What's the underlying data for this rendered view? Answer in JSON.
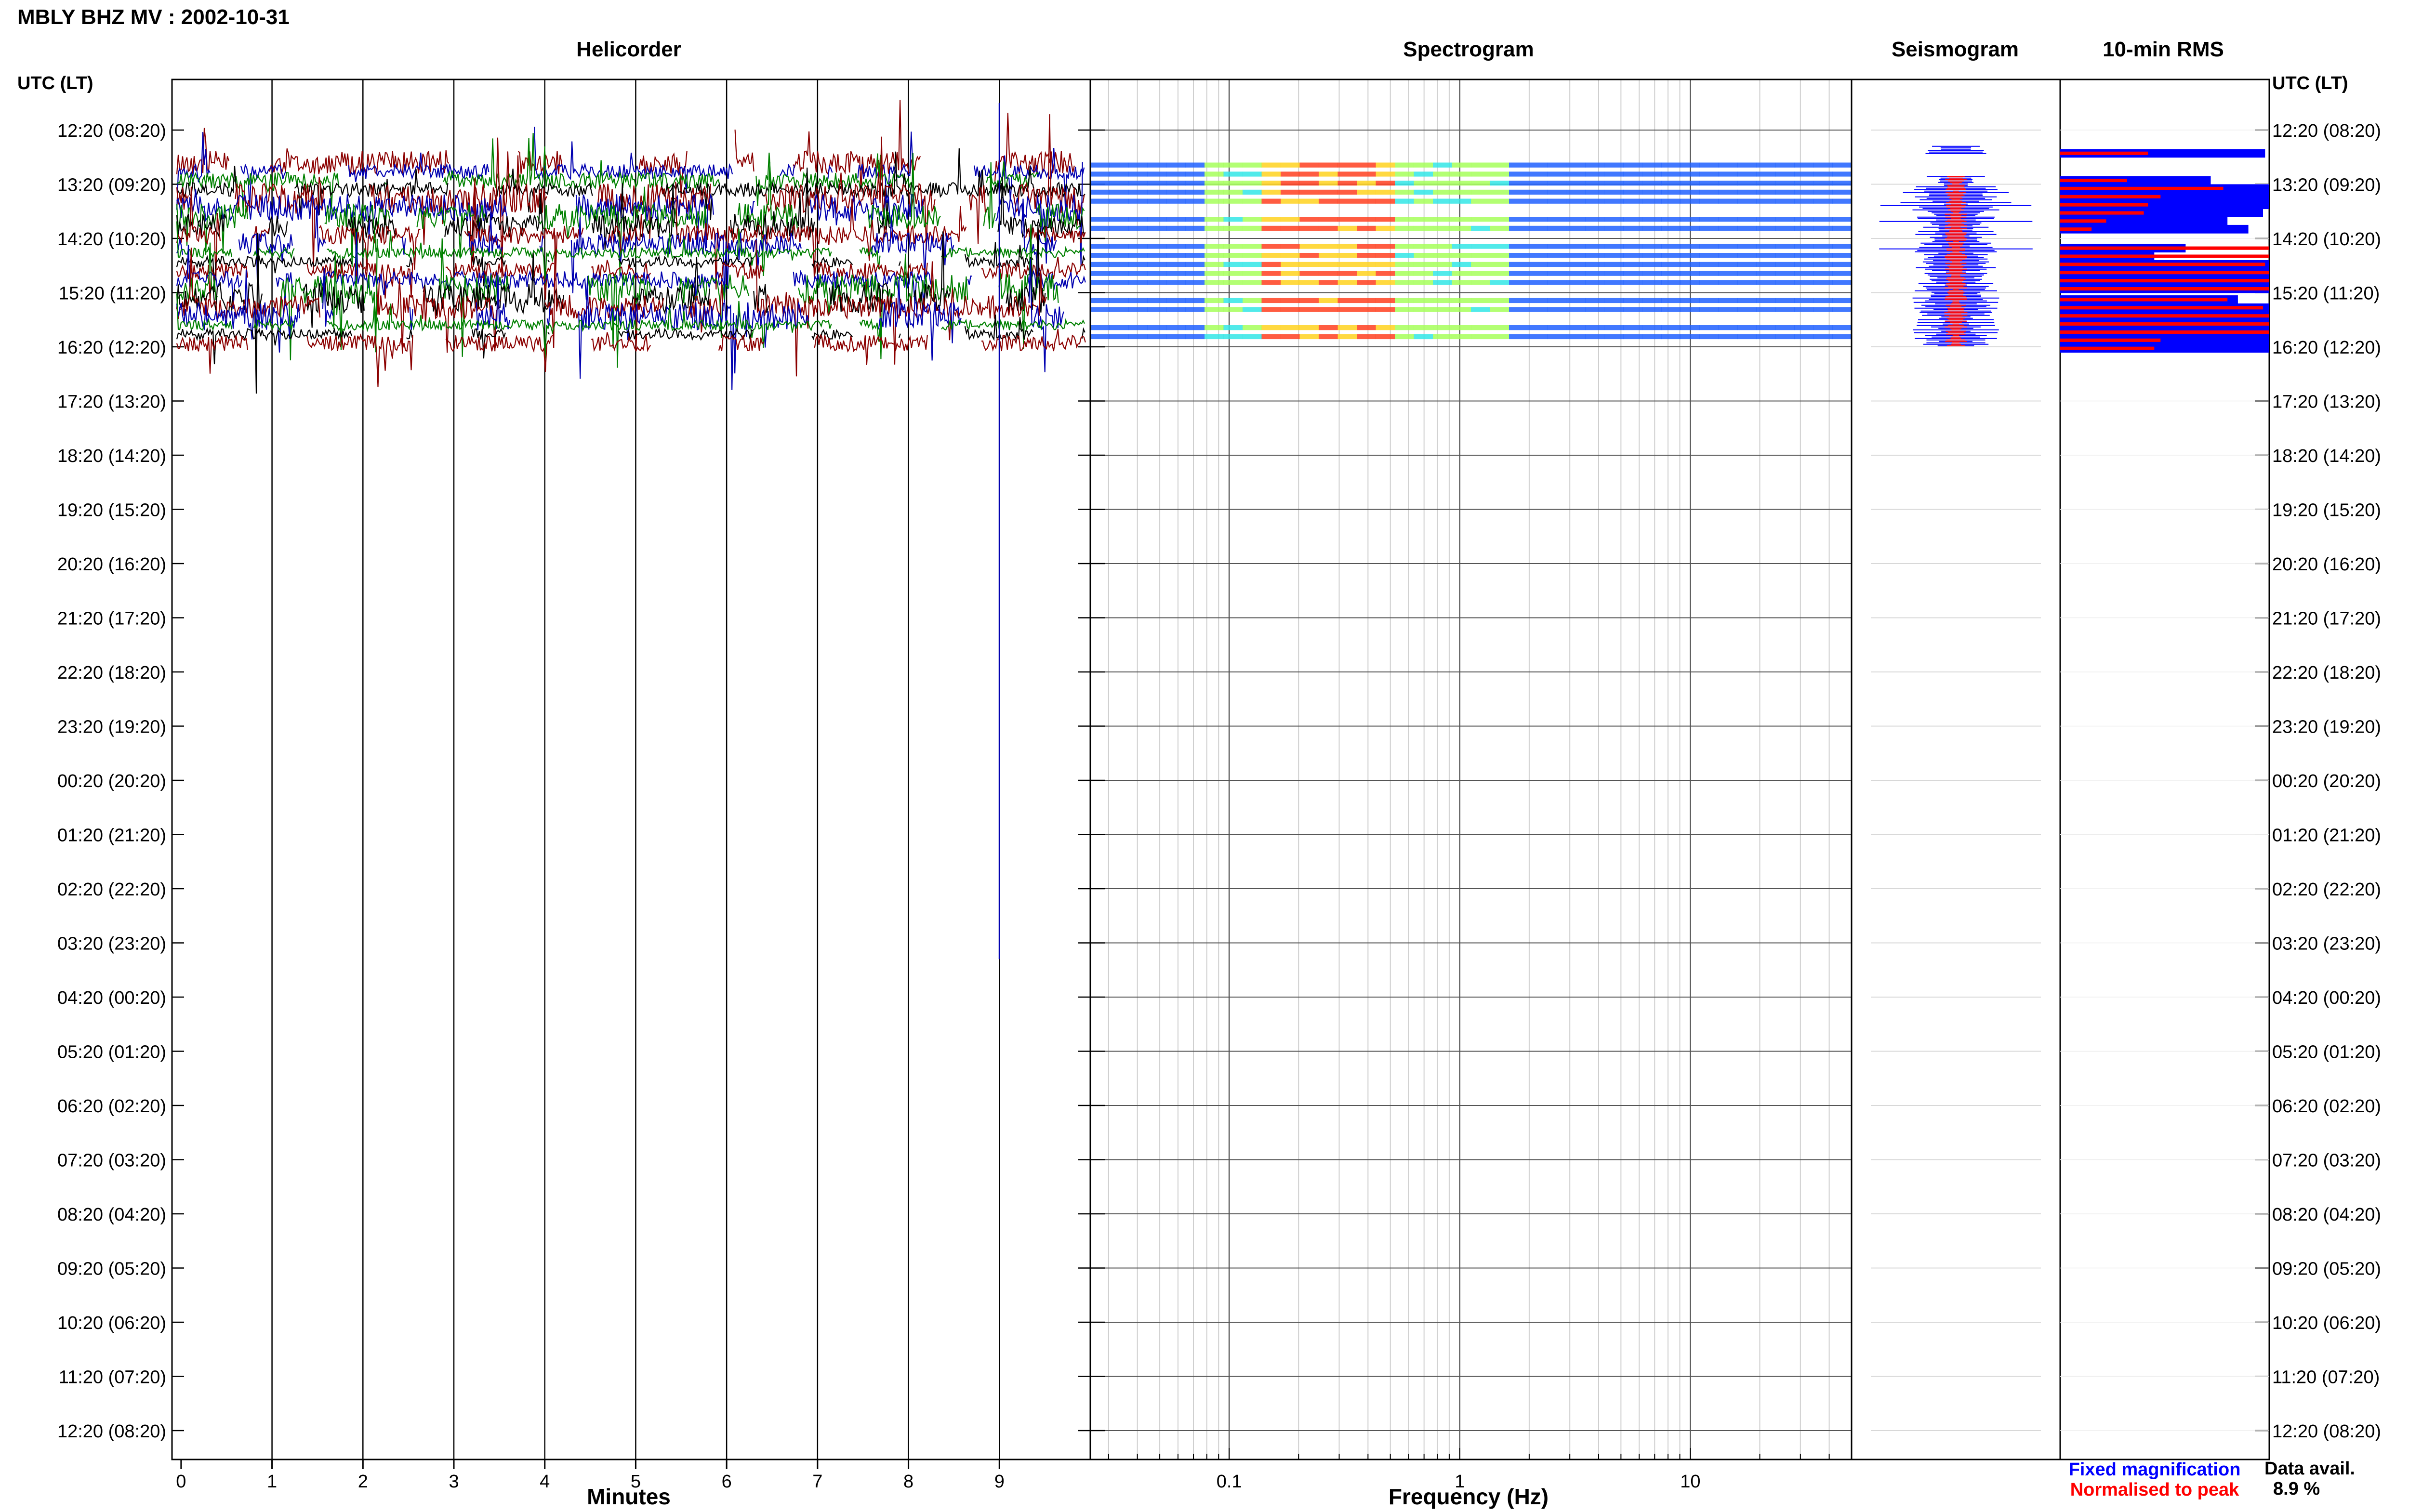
{
  "figure": {
    "header": "MBLY BHZ MV : 2002-10-31",
    "axis_heading": "UTC (LT)",
    "panel_titles": {
      "helicorder": "Helicorder",
      "spectrogram": "Spectrogram",
      "seismogram": "Seismogram",
      "rms": "10-min RMS"
    },
    "legend": {
      "fixed": "Fixed magnification",
      "normalised": "Normalised to peak",
      "fixed_color": "#0000ff",
      "normalised_color": "#ff0000"
    },
    "data_avail": {
      "label": "Data avail.",
      "value": "8.9 %"
    }
  },
  "chart_data": [
    {
      "type": "line",
      "panel": "Helicorder",
      "xlabel": "Minutes",
      "xlim": [
        -0.1,
        10.0
      ],
      "x_ticks": [
        "0",
        "1",
        "2",
        "3",
        "4",
        "5",
        "6",
        "7",
        "8",
        "9"
      ],
      "y_ticks": [
        "12:20 (08:20)",
        "13:20 (09:20)",
        "14:20 (10:20)",
        "15:20 (11:20)",
        "16:20 (12:20)",
        "17:20 (13:20)",
        "18:20 (14:20)",
        "19:20 (15:20)",
        "20:20 (16:20)",
        "21:20 (17:20)",
        "22:20 (18:20)",
        "23:20 (19:20)",
        "00:20 (20:20)",
        "01:20 (21:20)",
        "02:20 (22:20)",
        "03:20 (23:20)",
        "04:20 (00:20)",
        "05:20 (01:20)",
        "06:20 (02:20)",
        "07:20 (03:20)",
        "08:20 (04:20)",
        "09:20 (05:20)",
        "10:20 (06:20)",
        "11:20 (07:20)",
        "12:20 (08:20)"
      ],
      "line_colors": [
        "#8b0000",
        "#0000b0",
        "#008000",
        "#000000"
      ],
      "traces_per_hour": 6,
      "data_hours_start": 0.6,
      "data_hours_end": 4.0,
      "spike_minute": 9.0,
      "grid": true
    },
    {
      "type": "heatmap",
      "panel": "Spectrogram",
      "xlabel": "Frequency (Hz)",
      "x_scale": "log",
      "xlim": [
        0.025,
        50
      ],
      "x_ticks": [
        "0.1",
        "1",
        "10"
      ],
      "data_hours_start": 0.6,
      "data_hours_end": 4.0,
      "peak_frequency_hz": [
        0.15,
        0.5
      ],
      "grid": true
    },
    {
      "type": "line",
      "panel": "Seismogram",
      "data_hours_start": 0.3,
      "data_hours_end": 4.0,
      "colors": {
        "fixed": "#0000ff",
        "normalised": "#ff0000"
      }
    },
    {
      "type": "bar",
      "panel": "10-min RMS",
      "orientation": "horizontal",
      "series": [
        {
          "name": "Fixed magnification",
          "color": "#0000ff"
        },
        {
          "name": "Normalised to peak",
          "color": "#ff0000"
        }
      ],
      "hour_offsets": [
        0.35,
        0.85,
        1.0,
        1.15,
        1.3,
        1.45,
        1.6,
        1.75,
        2.1,
        2.25,
        2.4,
        2.55,
        2.7,
        2.85,
        3.05,
        3.2,
        3.35,
        3.5,
        3.65,
        3.8,
        3.95
      ],
      "fixed_values": [
        0.98,
        0.72,
        1.0,
        1.0,
        1.0,
        0.97,
        0.8,
        0.9,
        0.6,
        0.45,
        1.0,
        1.0,
        1.0,
        1.0,
        0.85,
        1.0,
        1.0,
        1.0,
        1.0,
        1.0,
        1.0
      ],
      "normalised_values": [
        0.42,
        0.32,
        0.78,
        0.48,
        0.42,
        0.4,
        0.22,
        0.15,
        1.0,
        1.0,
        0.98,
        1.0,
        1.0,
        1.0,
        0.8,
        0.97,
        1.0,
        1.0,
        1.0,
        0.48,
        0.45
      ],
      "xlim": [
        0,
        1
      ]
    }
  ]
}
